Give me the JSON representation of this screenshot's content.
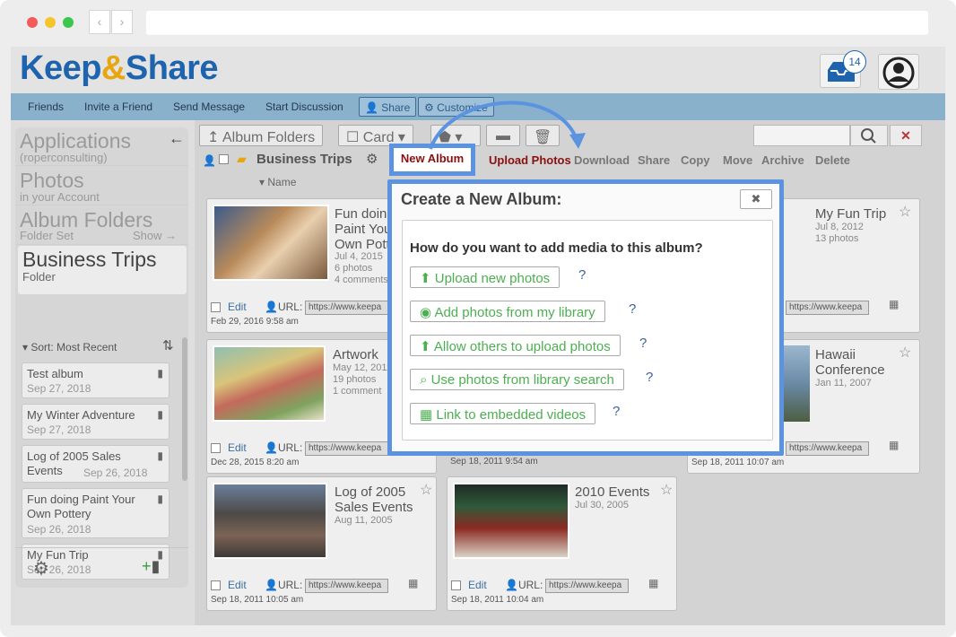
{
  "header": {
    "logo": "Keep&Share",
    "logo_main": "Keep",
    "logo_amp": "&",
    "logo_end": "Share",
    "inbox_count": "14"
  },
  "topnav": {
    "items": [
      "Friends",
      "Invite a Friend",
      "Send Message",
      "Start Discussion"
    ],
    "share": "Share",
    "customize": "Customize"
  },
  "sidebar": {
    "applications": "Applications",
    "applications_sub": "(roperconsulting)",
    "photos": "Photos",
    "photos_sub": "in your Account",
    "album_folders": "Album Folders",
    "album_folders_sub": "Folder Set",
    "show": "Show",
    "current": "Business Trips",
    "current_sub": "Folder",
    "sort": "Sort: Most Recent",
    "albums": [
      {
        "name": "Test album",
        "date": "Sep 27, 2018"
      },
      {
        "name": "My Winter Adventure",
        "date": "Sep 27, 2018"
      },
      {
        "name": "Log of 2005 Sales Events",
        "date": "Sep 26, 2018"
      },
      {
        "name": "Fun doing Paint Your Own Pottery",
        "date": "Sep 26, 2018"
      },
      {
        "name": "My Fun Trip",
        "date": "Sep 26, 2018"
      }
    ]
  },
  "toolbar": {
    "album_folders": "Album Folders",
    "card": "Card",
    "folder": "Business Trips",
    "name_col": "Name"
  },
  "actions": {
    "new_album": "New Album",
    "upload_photos": "Upload Photos",
    "download": "Download",
    "share": "Share",
    "copy": "Copy",
    "move": "Move",
    "archive": "Archive",
    "delete": "Delete"
  },
  "cards": [
    {
      "title": "Fun doing Paint Your Own Pottery",
      "line1": "Fun doing",
      "line2": "Paint You",
      "line3": "Own Pott",
      "date": "Jul 4, 2015",
      "photos": "6 photos",
      "comments": "4 comments",
      "created": "Feb 29, 2016 9:58 am"
    },
    {
      "title": "Artwork",
      "date": "May 12, 2011",
      "photos": "19 photos",
      "comments": "1 comment",
      "created": "Dec 28, 2015 8:20 am"
    },
    {
      "title": "My Fun Trip",
      "date": "Jul 8, 2012",
      "photos": "13 photos",
      "created": ""
    },
    {
      "title": "Hawaii Conference",
      "line1": "Hawaii",
      "line2": "Conference",
      "date": "Jan 11, 2007",
      "created": "Sep 18, 2011 10:07 am"
    },
    {
      "title": "Log of 2005 Sales Events",
      "line1": "Log of 2005",
      "line2": "Sales Events",
      "date": "Aug 11, 2005",
      "created": "Sep 18, 2011 10:05 am"
    },
    {
      "title": "2010 Events",
      "date": "Jul 30, 2005",
      "created": "Sep 18, 2011 10:04 am"
    }
  ],
  "middle_created": "Sep 18, 2011 9:54 am",
  "card_edit": "Edit",
  "card_url_label": "URL:",
  "card_url": "https://www.keepa",
  "modal": {
    "title": "Create a New Album:",
    "question": "How do you want to add media to this album?",
    "options": [
      "Upload new photos",
      "Add photos from my library",
      "Allow others to upload photos",
      "Use photos from library search",
      "Link to embedded videos"
    ],
    "help": "?"
  },
  "colors": {
    "brand_blue": "#1e63ad",
    "brand_orange": "#e8a50f",
    "highlight": "#5b93e0",
    "option_green": "#4caf50"
  }
}
